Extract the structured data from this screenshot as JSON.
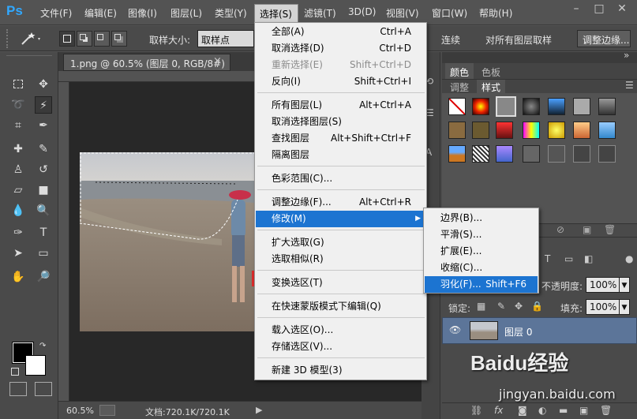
{
  "app": {
    "logo": "Ps"
  },
  "menubar": {
    "items": [
      "文件(F)",
      "编辑(E)",
      "图像(I)",
      "图层(L)",
      "类型(Y)",
      "选择(S)",
      "滤镜(T)",
      "3D(D)",
      "视图(V)",
      "窗口(W)",
      "帮助(H)"
    ],
    "window_controls": [
      "–",
      "□",
      "✕"
    ]
  },
  "options": {
    "sample_size_label": "取样大小:",
    "sample_size_value": "取样点",
    "contiguous_label": "连续",
    "all_layers_label": "对所有图层取样",
    "refine_edge_button": "调整边缘..."
  },
  "document": {
    "tab_title": "1.png @ 60.5% (图层 0, RGB/8#)",
    "close": "×",
    "zoom": "60.5%",
    "doc_info": "文档:720.1K/720.1K"
  },
  "select_menu": {
    "items": [
      {
        "label": "全部(A)",
        "shortcut": "Ctrl+A",
        "disabled": false
      },
      {
        "label": "取消选择(D)",
        "shortcut": "Ctrl+D",
        "disabled": false
      },
      {
        "label": "重新选择(E)",
        "shortcut": "Shift+Ctrl+D",
        "disabled": true
      },
      {
        "label": "反向(I)",
        "shortcut": "Shift+Ctrl+I",
        "disabled": false
      },
      {
        "label": "所有图层(L)",
        "shortcut": "Alt+Ctrl+A",
        "disabled": false
      },
      {
        "label": "取消选择图层(S)",
        "shortcut": "",
        "disabled": false
      },
      {
        "label": "查找图层",
        "shortcut": "Alt+Shift+Ctrl+F",
        "disabled": false
      },
      {
        "label": "隔离图层",
        "shortcut": "",
        "disabled": false
      },
      {
        "label": "色彩范围(C)...",
        "shortcut": "",
        "disabled": false
      },
      {
        "label": "调整边缘(F)...",
        "shortcut": "Alt+Ctrl+R",
        "disabled": false
      },
      {
        "label": "修改(M)",
        "shortcut": "",
        "disabled": false
      },
      {
        "label": "扩大选取(G)",
        "shortcut": "",
        "disabled": false
      },
      {
        "label": "选取相似(R)",
        "shortcut": "",
        "disabled": false
      },
      {
        "label": "变换选区(T)",
        "shortcut": "",
        "disabled": false
      },
      {
        "label": "在快速蒙版模式下编辑(Q)",
        "shortcut": "",
        "disabled": false
      },
      {
        "label": "载入选区(O)...",
        "shortcut": "",
        "disabled": false
      },
      {
        "label": "存储选区(V)...",
        "shortcut": "",
        "disabled": false
      },
      {
        "label": "新建 3D 模型(3)",
        "shortcut": "",
        "disabled": false
      }
    ]
  },
  "modify_submenu": {
    "items": [
      {
        "label": "边界(B)...",
        "shortcut": ""
      },
      {
        "label": "平滑(S)...",
        "shortcut": ""
      },
      {
        "label": "扩展(E)...",
        "shortcut": ""
      },
      {
        "label": "收缩(C)...",
        "shortcut": ""
      },
      {
        "label": "羽化(F)...",
        "shortcut": "Shift+F6"
      }
    ],
    "highlighted": "羽化(F)..."
  },
  "panels": {
    "color_tabs": [
      "颜色",
      "色板"
    ],
    "style_tabs": [
      "调整",
      "样式"
    ],
    "opacity_label": "不透明度:",
    "opacity_value": "100%",
    "lock_label": "锁定:",
    "fill_label": "填充:",
    "fill_value": "100%",
    "layer_name": "图层 0"
  },
  "watermark": {
    "brand": "Baidu经验",
    "url": "jingyan.baidu.com"
  },
  "colors": {
    "menu_highlight": "#1c74d1",
    "ps_blue": "#31a8ff",
    "layer_selected": "#5c7599"
  }
}
